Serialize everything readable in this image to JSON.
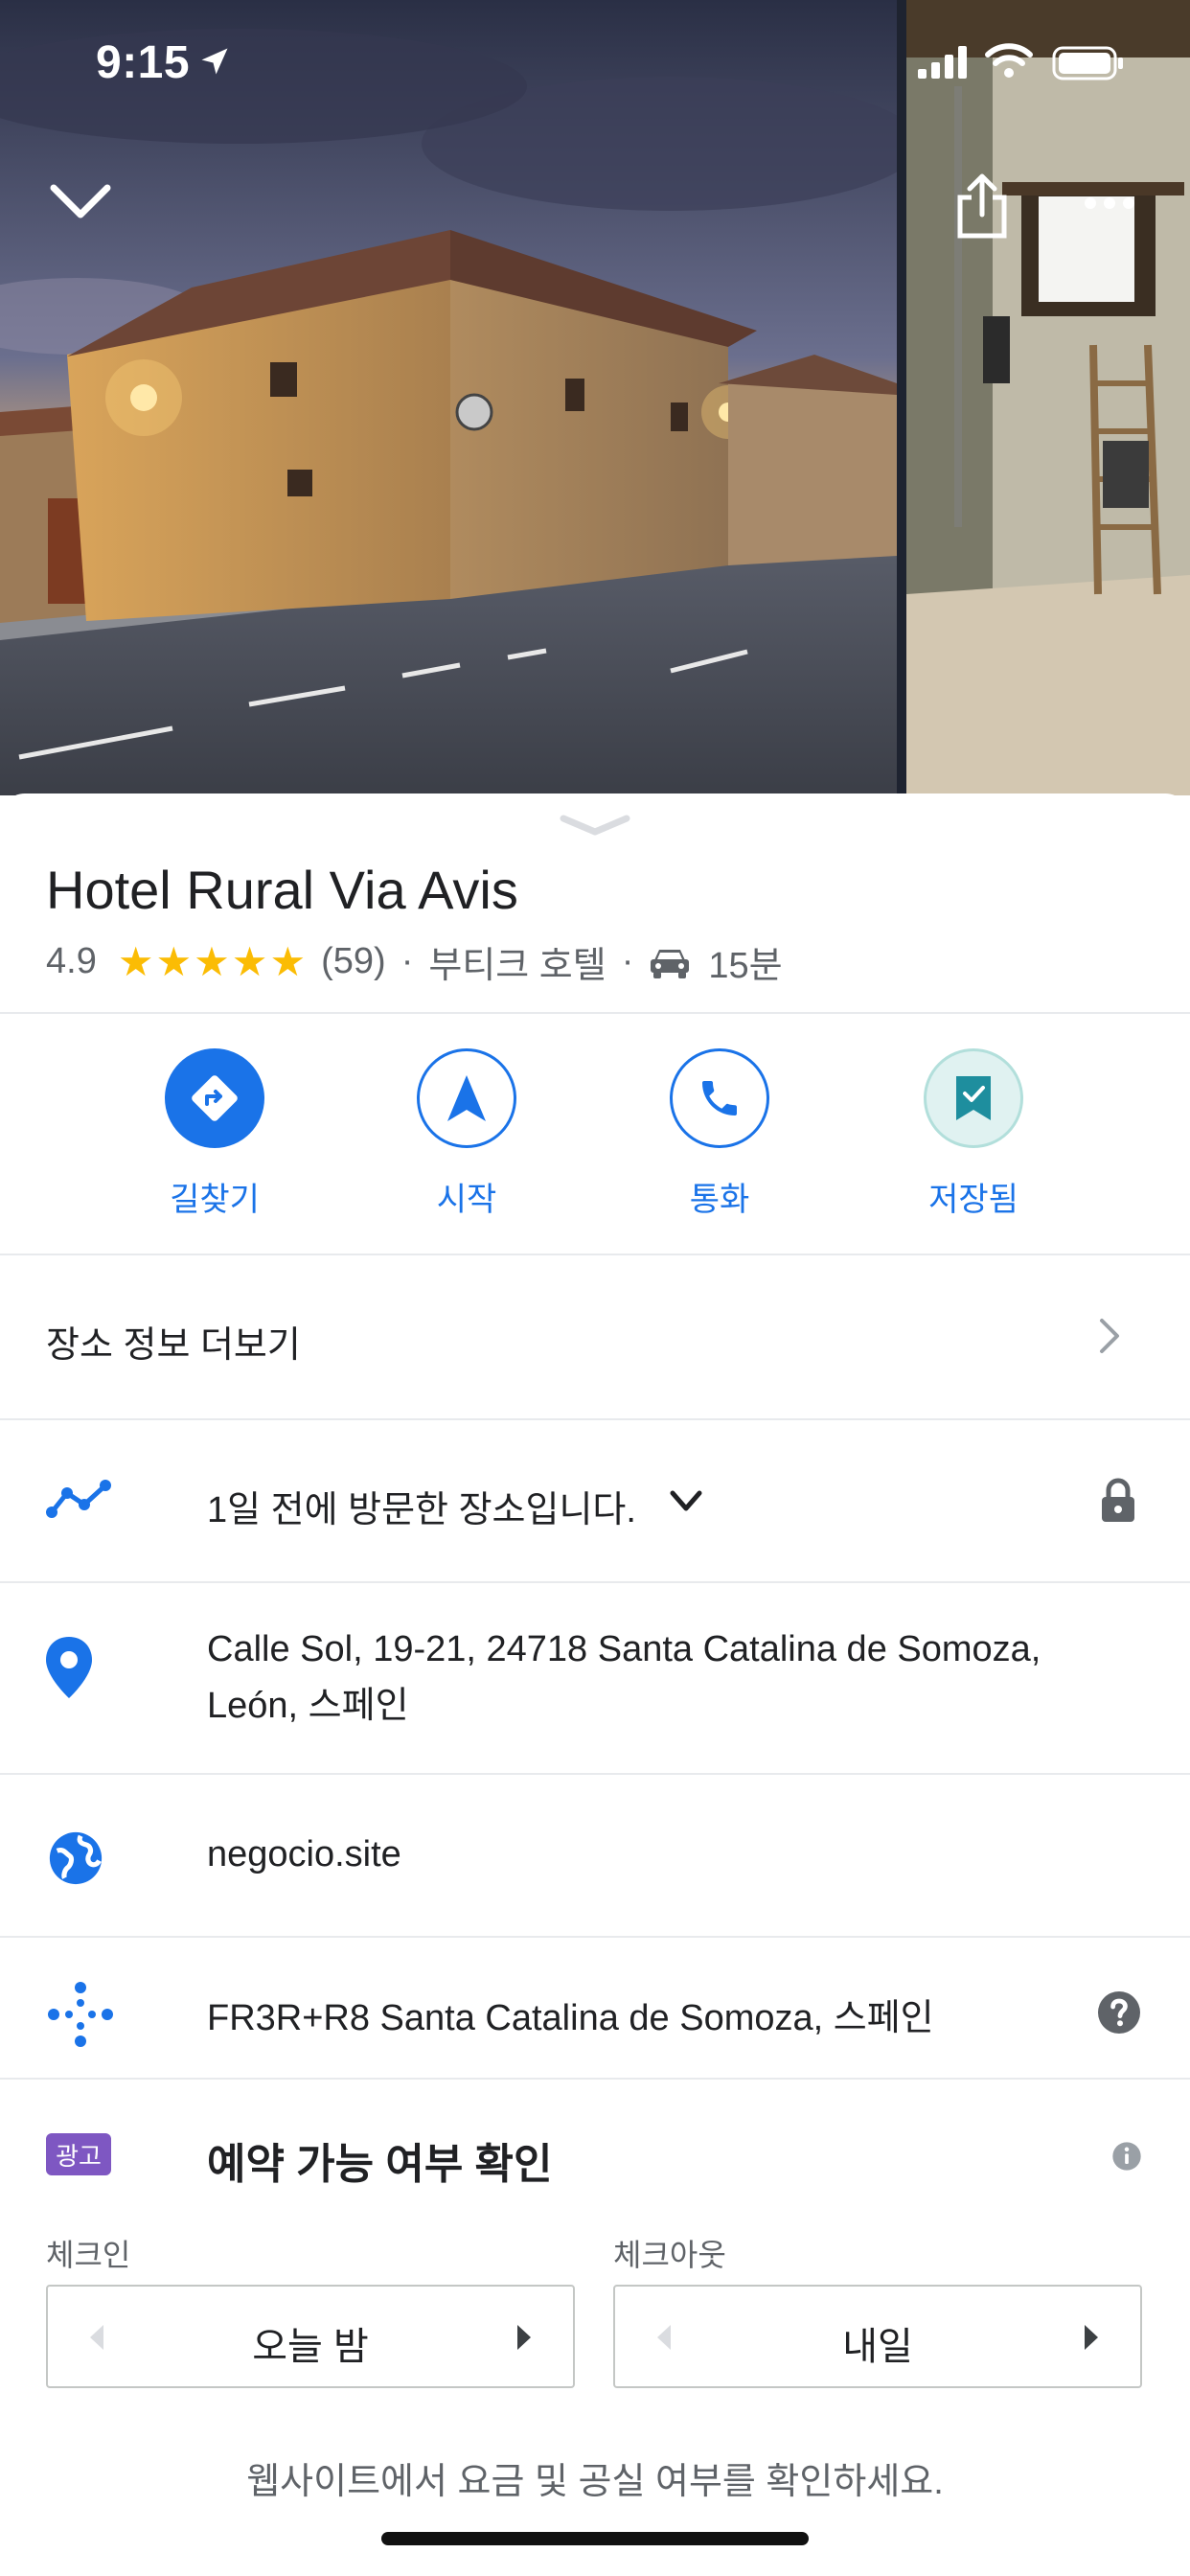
{
  "status_bar": {
    "time": "9:15"
  },
  "place": {
    "name": "Hotel Rural Via Avis",
    "rating": "4.9",
    "stars": 5,
    "review_count": "(59)",
    "category": "부티크 호텔",
    "drive_time": "15분"
  },
  "actions": [
    {
      "label": "길찾기",
      "icon": "directions-icon"
    },
    {
      "label": "시작",
      "icon": "navigation-arrow-icon"
    },
    {
      "label": "통화",
      "icon": "phone-icon"
    },
    {
      "label": "저장됨",
      "icon": "bookmark-saved-icon"
    }
  ],
  "more_info": "장소 정보 더보기",
  "visited": "1일 전에 방문한 장소입니다.",
  "address": {
    "line1": "Calle Sol, 19-21, 24718 Santa Catalina de Somoza,",
    "line2": "León, 스페인"
  },
  "website": "negocio.site",
  "plus_code": "FR3R+R8 Santa Catalina de Somoza, 스페인",
  "booking": {
    "ad_badge": "광고",
    "title": "예약 가능 여부 확인",
    "checkin_label": "체크인",
    "checkin_value": "오늘 밤",
    "checkout_label": "체크아웃",
    "checkout_value": "내일",
    "note": "웹사이트에서 요금 및 공실 여부를 확인하세요."
  },
  "colors": {
    "accent": "#1a73e8",
    "star": "#fbbc04",
    "ad": "#7e57c2"
  }
}
